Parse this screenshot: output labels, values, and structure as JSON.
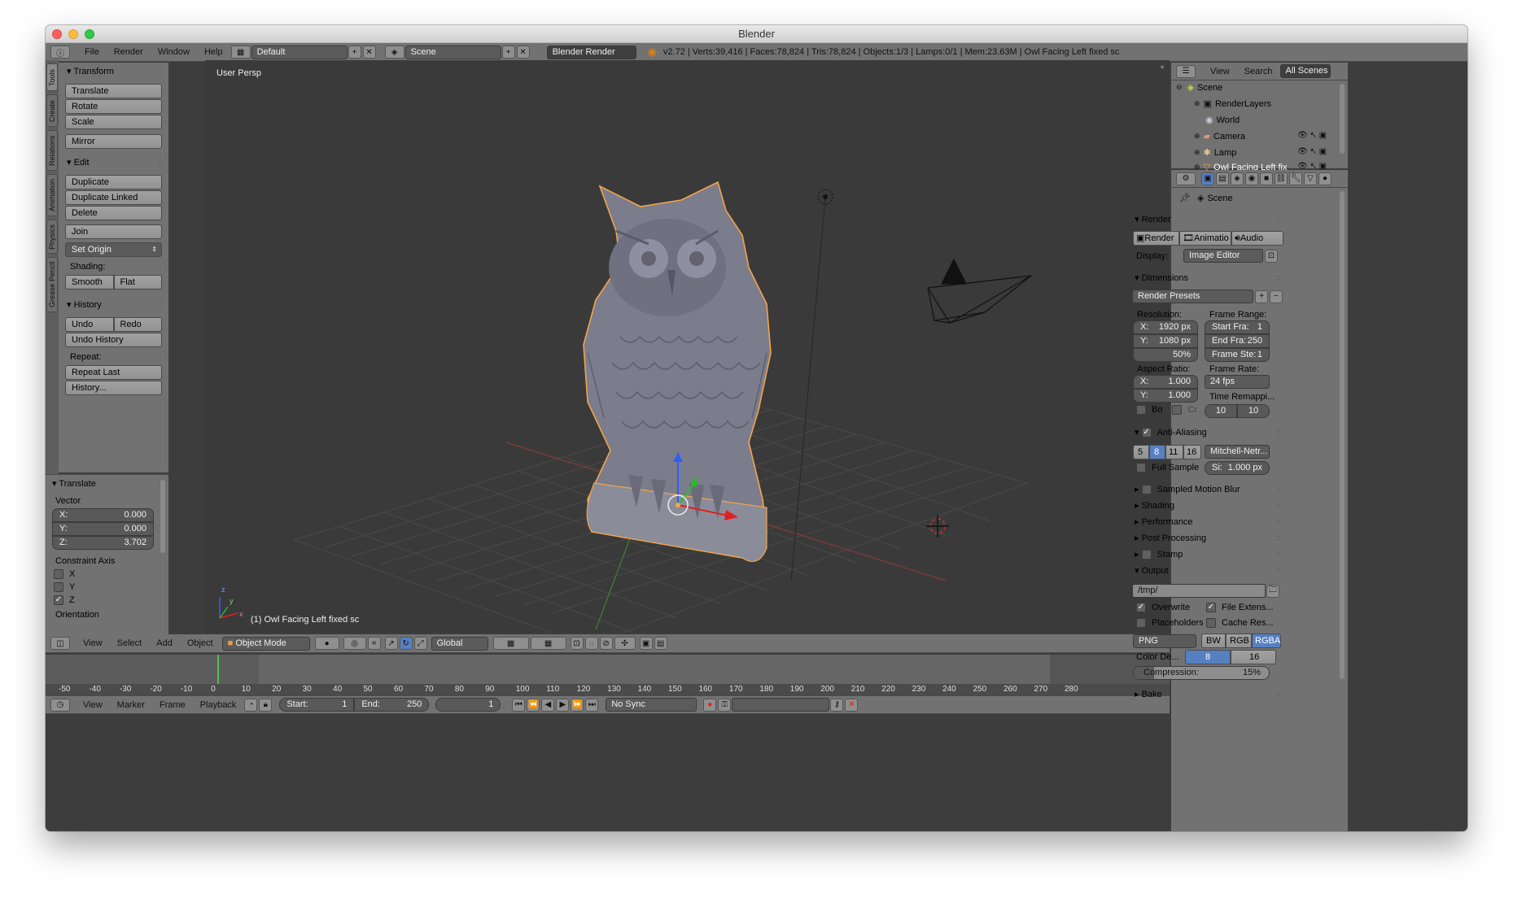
{
  "window": {
    "title": "Blender"
  },
  "topbar": {
    "menus": [
      "File",
      "Render",
      "Window",
      "Help"
    ],
    "screen_layout": "Default",
    "scene": "Scene",
    "engine": "Blender Render",
    "stats": "v2.72 | Verts:39,416 | Faces:78,824 | Tris:78,824 | Objects:1/3 | Lamps:0/1 | Mem:23.63M | Owl Facing Left fixed sc"
  },
  "tool_tabs": [
    "Tools",
    "Create",
    "Relations",
    "Animation",
    "Physics",
    "Grease Pencil"
  ],
  "toolshelf": {
    "transform": {
      "title": "Transform",
      "buttons": [
        "Translate",
        "Rotate",
        "Scale",
        "Mirror"
      ]
    },
    "edit": {
      "title": "Edit",
      "buttons": [
        "Duplicate",
        "Duplicate Linked",
        "Delete",
        "Join"
      ],
      "set_origin": "Set Origin",
      "shading_label": "Shading:",
      "smooth": "Smooth",
      "flat": "Flat"
    },
    "history": {
      "title": "History",
      "undo": "Undo",
      "redo": "Redo",
      "undo_history": "Undo History",
      "repeat_label": "Repeat:",
      "repeat_last": "Repeat Last",
      "history": "History..."
    }
  },
  "operator": {
    "title": "Translate",
    "vector_label": "Vector",
    "x_label": "X:",
    "x": "0.000",
    "y_label": "Y:",
    "y": "0.000",
    "z_label": "Z:",
    "z": "3.702",
    "constraint_label": "Constraint Axis",
    "axes": [
      {
        "name": "X",
        "checked": false
      },
      {
        "name": "Y",
        "checked": false
      },
      {
        "name": "Z",
        "checked": true
      }
    ],
    "orientation_label": "Orientation"
  },
  "viewport": {
    "view_name": "User Persp",
    "object_label": "(1) Owl Facing Left fixed sc",
    "axis_x": "x",
    "axis_y": "y",
    "axis_z": "z"
  },
  "viewport_header": {
    "menus": [
      "View",
      "Select",
      "Add",
      "Object"
    ],
    "mode": "Object Mode",
    "orientation": "Global"
  },
  "timeline": {
    "ticks": [
      "-50",
      "-40",
      "-30",
      "-20",
      "-10",
      "0",
      "10",
      "20",
      "30",
      "40",
      "50",
      "60",
      "70",
      "80",
      "90",
      "100",
      "110",
      "120",
      "130",
      "140",
      "150",
      "160",
      "170",
      "180",
      "190",
      "200",
      "210",
      "220",
      "230",
      "240",
      "250",
      "260",
      "270",
      "280"
    ],
    "current_frame_value": 0,
    "menus": [
      "View",
      "Marker",
      "Frame",
      "Playback"
    ],
    "start_label": "Start:",
    "start": "1",
    "end_label": "End:",
    "end": "250",
    "current": "1",
    "sync": "No Sync"
  },
  "outliner": {
    "menus": [
      "View",
      "Search"
    ],
    "filter": "All Scenes",
    "items": [
      {
        "label": "Scene",
        "depth": 0
      },
      {
        "label": "RenderLayers",
        "depth": 1
      },
      {
        "label": "World",
        "depth": 1
      },
      {
        "label": "Camera",
        "depth": 1
      },
      {
        "label": "Lamp",
        "depth": 1
      },
      {
        "label": "Owl Facing Left fix",
        "depth": 1
      }
    ]
  },
  "properties": {
    "breadcrumb": "Scene",
    "render": {
      "title": "Render",
      "render_btn": "Render",
      "animation_btn": "Animatio",
      "audio_btn": "Audio",
      "display_label": "Display:",
      "display": "Image Editor"
    },
    "dimensions": {
      "title": "Dimensions",
      "presets": "Render Presets",
      "resolution_label": "Resolution:",
      "res_x_label": "X:",
      "res_x": "1920 px",
      "res_y_label": "Y:",
      "res_y": "1080 px",
      "res_pct": "50%",
      "frame_range_label": "Frame Range:",
      "start_label": "Start Fra:",
      "start": "1",
      "end_label": "End Fra:",
      "end": "250",
      "step_label": "Frame Ste:",
      "step": "1",
      "aspect_label": "Aspect Ratio:",
      "aspect_x_label": "X:",
      "aspect_x": "1.000",
      "aspect_y_label": "Y:",
      "aspect_y": "1.000",
      "frame_rate_label": "Frame Rate:",
      "frame_rate": "24 fps",
      "remap_label": "Time Remappi...",
      "remap_old": "10",
      "remap_new": "10",
      "border_label": "Bo",
      "crop_label": "Cr"
    },
    "antialiasing": {
      "title": "Anti-Aliasing",
      "samples": [
        "5",
        "8",
        "11",
        "16"
      ],
      "selected": "8",
      "filter": "Mitchell-Netr...",
      "full_sample": "Full Sample",
      "size_label": "Si:",
      "size": "1.000 px"
    },
    "collapsed": [
      "Sampled Motion Blur",
      "Shading",
      "Performance",
      "Post Processing",
      "Stamp"
    ],
    "output": {
      "title": "Output",
      "path": "/tmp/",
      "overwrite": "Overwrite",
      "file_ext": "File Extens...",
      "placeholders": "Placeholders",
      "cache": "Cache Res...",
      "format": "PNG",
      "bw": "BW",
      "rgb": "RGB",
      "rgba": "RGBA",
      "color_depth_label": "Color De...",
      "depth8": "8",
      "depth16": "16",
      "compression_label": "Compression:",
      "compression": "15%",
      "compression_value": 15
    },
    "bake": {
      "title": "Bake"
    }
  },
  "colors": {
    "accent_blue": "#5680c2",
    "selection_orange": "#f2a54a",
    "frame_green": "#4ec24e"
  }
}
